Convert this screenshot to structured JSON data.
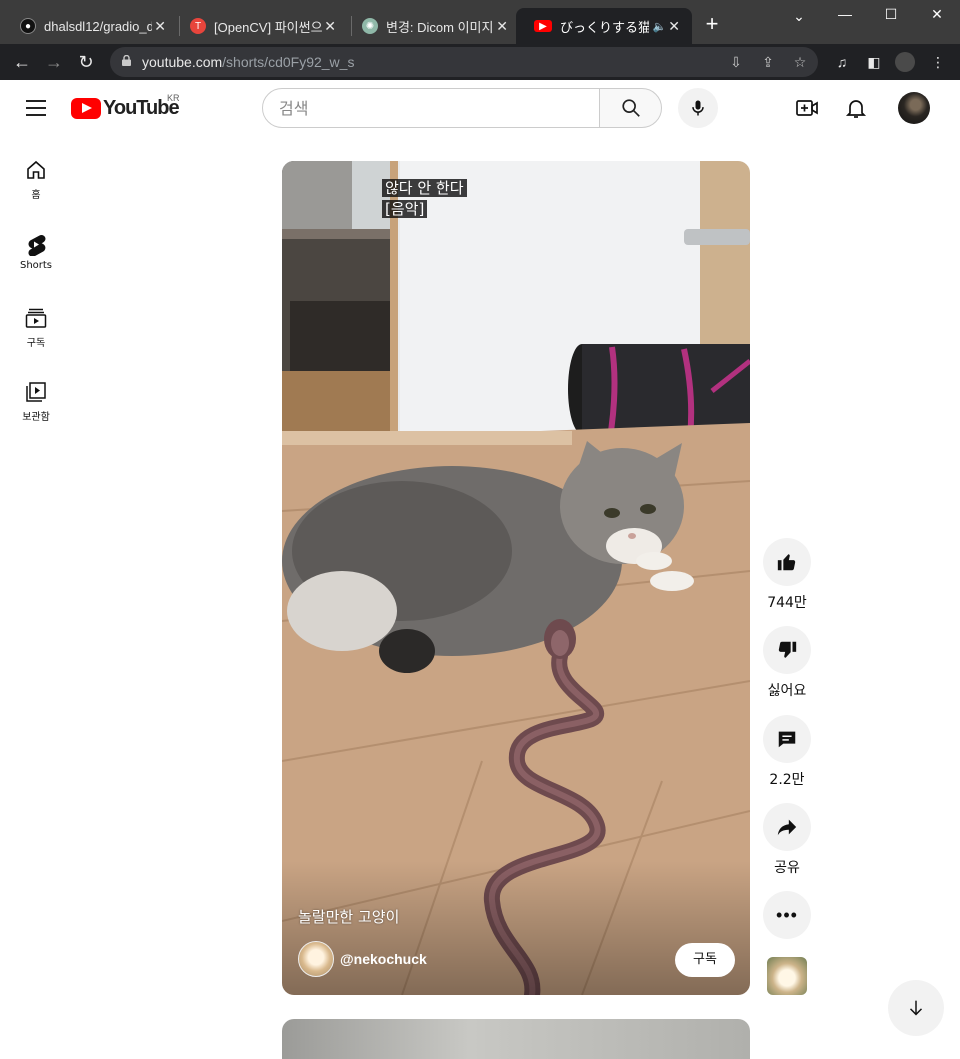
{
  "browser": {
    "tabs": [
      {
        "title": "dhalsdl12/gradio_d",
        "icon": "github-icon"
      },
      {
        "title": "[OpenCV] 파이썬으",
        "icon": "tistory-icon"
      },
      {
        "title": "변경: Dicom 이미지",
        "icon": "chatgpt-icon"
      },
      {
        "title": "びっくりする猫",
        "icon": "youtube-icon",
        "active": true
      }
    ],
    "address": {
      "host": "youtube.com",
      "path": "/shorts/cd0Fy92_w_s"
    }
  },
  "header": {
    "logo_text": "YouTube",
    "region": "KR",
    "search_placeholder": "검색"
  },
  "guide": [
    {
      "label": "홈",
      "icon": "home-icon"
    },
    {
      "label": "Shorts",
      "icon": "shorts-icon"
    },
    {
      "label": "구독",
      "icon": "subscriptions-icon"
    },
    {
      "label": "보관함",
      "icon": "library-icon"
    }
  ],
  "short": {
    "caption_lines": [
      "않다 안 한다",
      "[음악]"
    ],
    "title": "놀랄만한 고양이",
    "channel": "@nekochuck",
    "subscribe_label": "구독"
  },
  "actions": {
    "like_count": "744만",
    "dislike_label": "싫어요",
    "comment_count": "2.2만",
    "share_label": "공유"
  },
  "colors": {
    "brand": "#ff0000",
    "chrome_dark": "#202124",
    "tab_strip": "#3c3c3c"
  }
}
